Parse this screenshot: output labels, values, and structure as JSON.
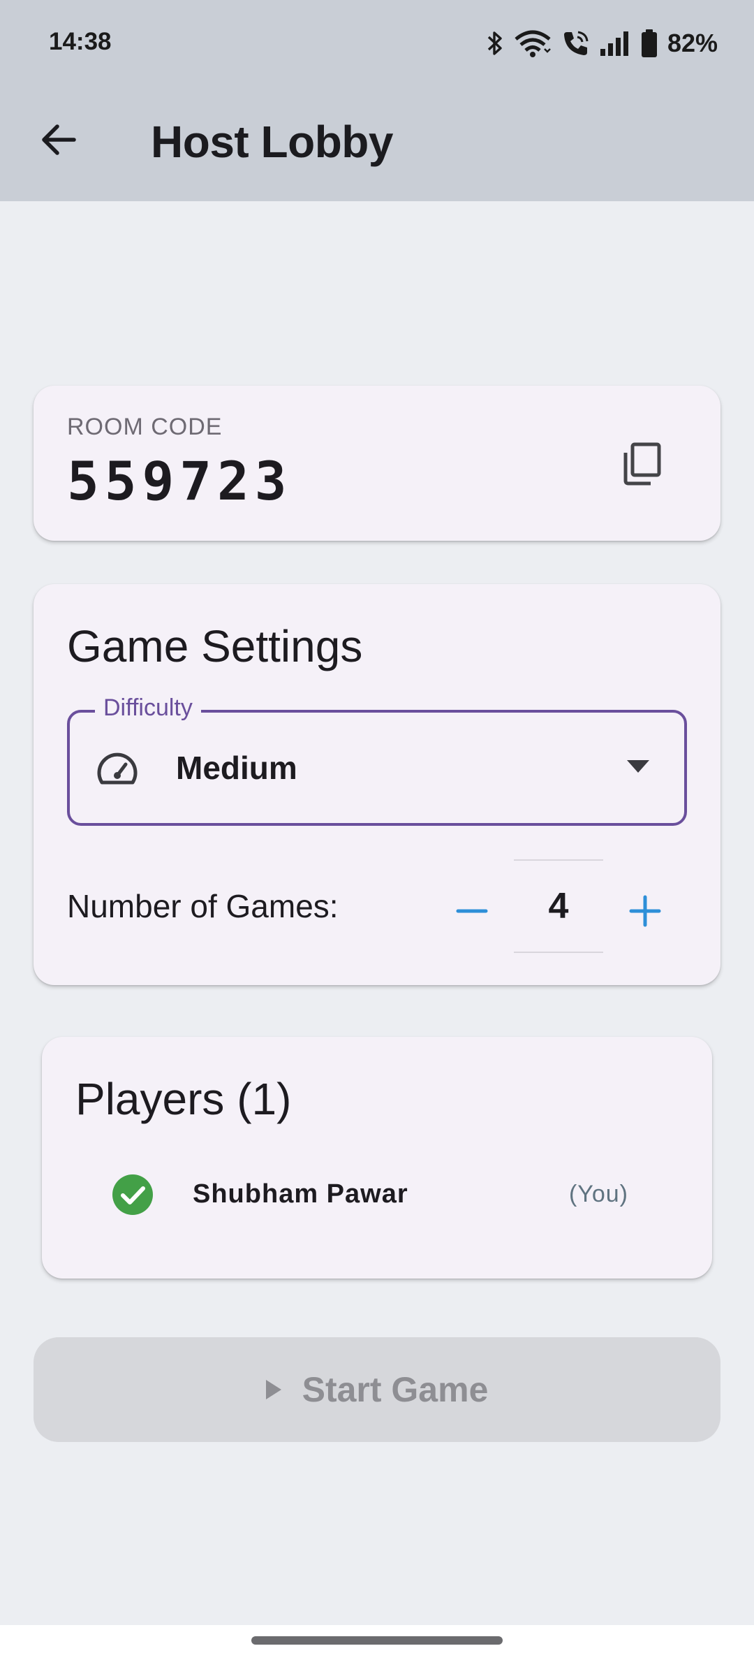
{
  "status_bar": {
    "time": "14:38",
    "battery_percent": "82%",
    "icons": [
      "bluetooth-icon",
      "wifi-icon",
      "wifi-call-icon",
      "signal-icon",
      "battery-icon"
    ]
  },
  "app_bar": {
    "title": "Host Lobby",
    "back_icon": "arrow-back-icon"
  },
  "room": {
    "label": "ROOM CODE",
    "code": "559723",
    "copy_icon": "copy-icon"
  },
  "settings": {
    "title": "Game Settings",
    "difficulty": {
      "label": "Difficulty",
      "value": "Medium",
      "icon": "speedometer-icon"
    },
    "games": {
      "label": "Number of Games:",
      "value": "4"
    }
  },
  "players": {
    "title": "Players (1)",
    "list": [
      {
        "name": "Shubham Pawar",
        "tag": "(You)",
        "status_icon": "check-circle-icon"
      }
    ]
  },
  "start_button": {
    "label": "Start Game",
    "icon": "play-icon",
    "enabled": false
  },
  "colors": {
    "app_bar": "#c9ced6",
    "background": "#eceef2",
    "card": "#f5f1f8",
    "accent": "#6a4f9c",
    "stepper": "#2d8fd8",
    "check": "#43a047",
    "disabled_button": "#d6d7db"
  }
}
